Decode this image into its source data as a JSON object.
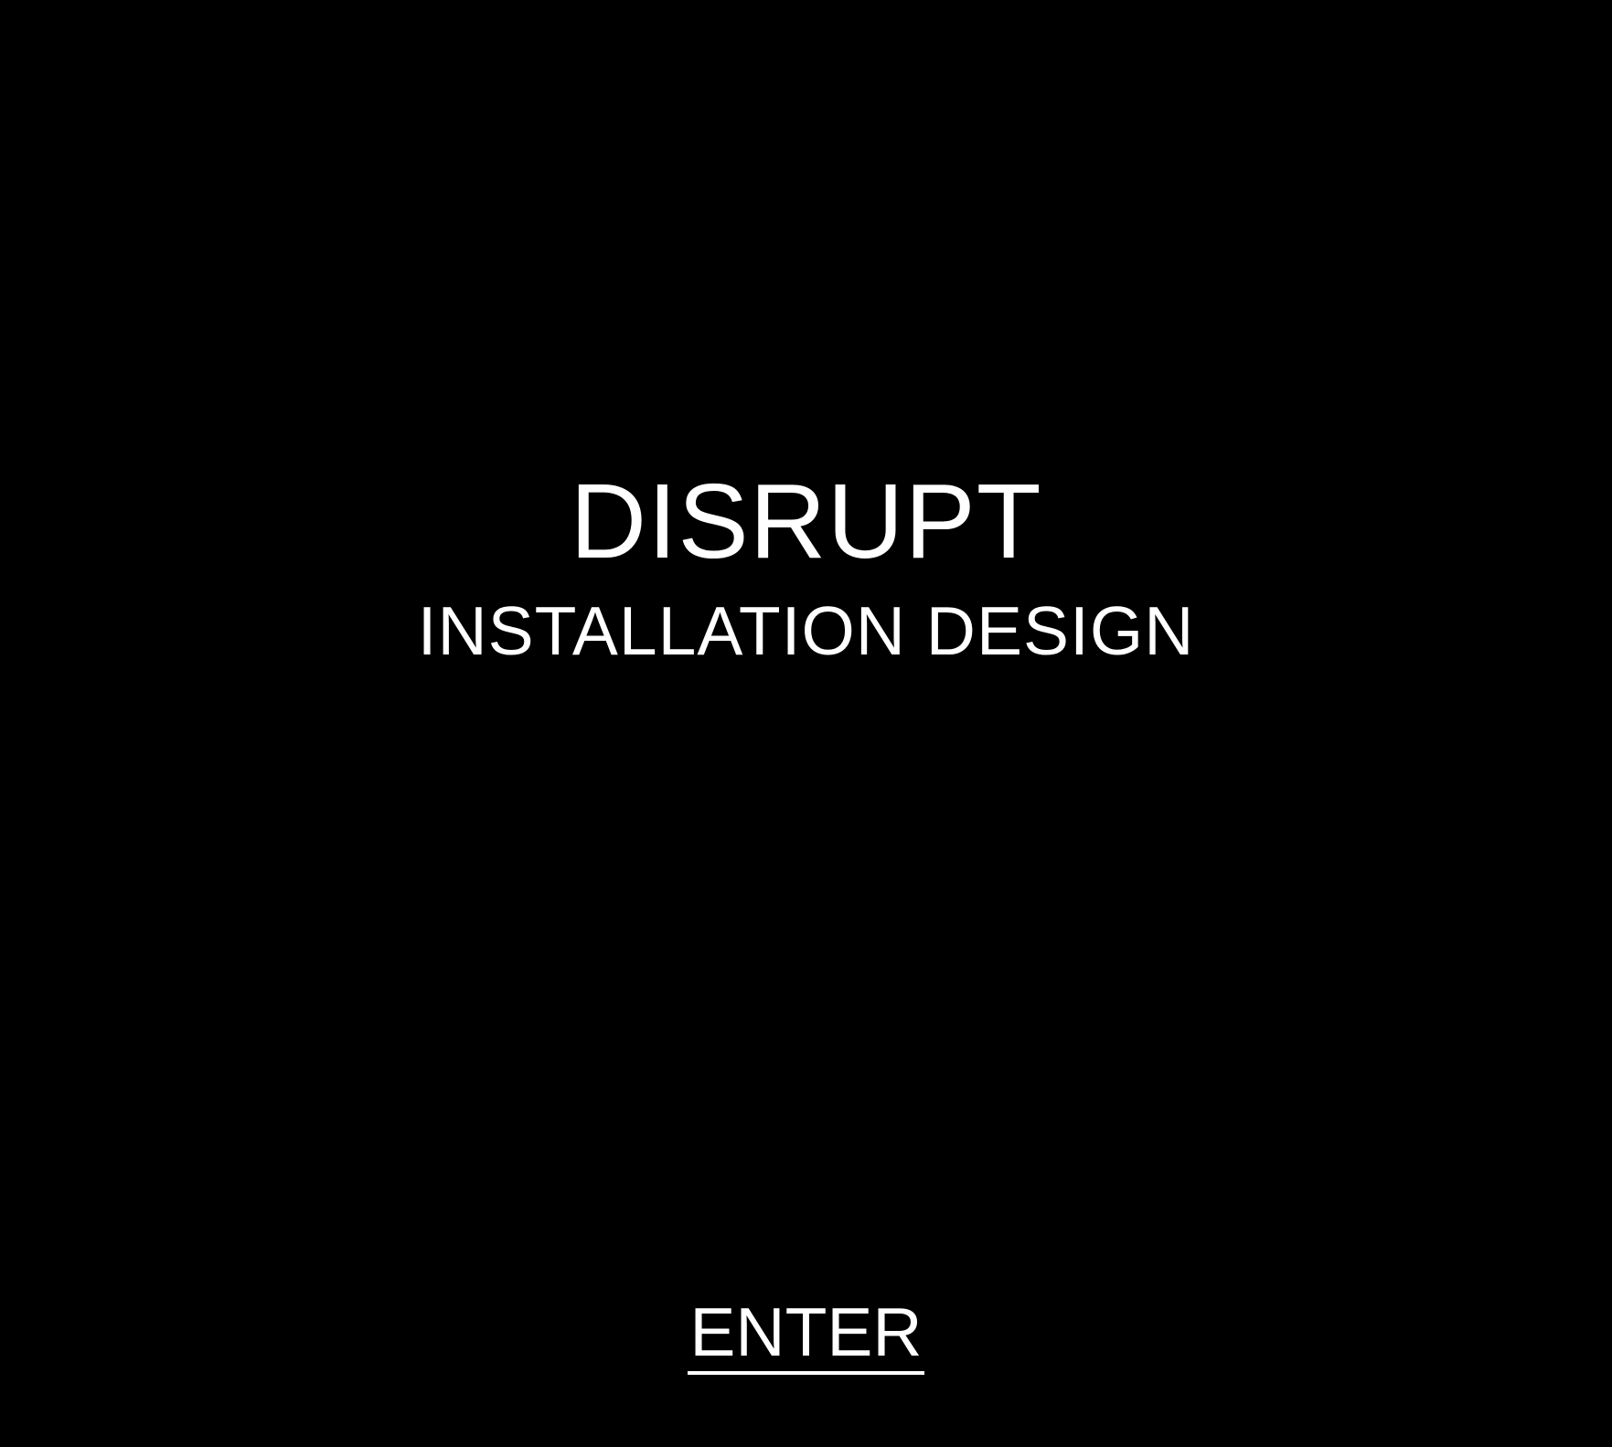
{
  "hero": {
    "title": "DISRUPT",
    "subtitle": "INSTALLATION DESIGN"
  },
  "actions": {
    "enter_label": "ENTER"
  },
  "colors": {
    "background": "#000000",
    "text": "#ffffff"
  }
}
